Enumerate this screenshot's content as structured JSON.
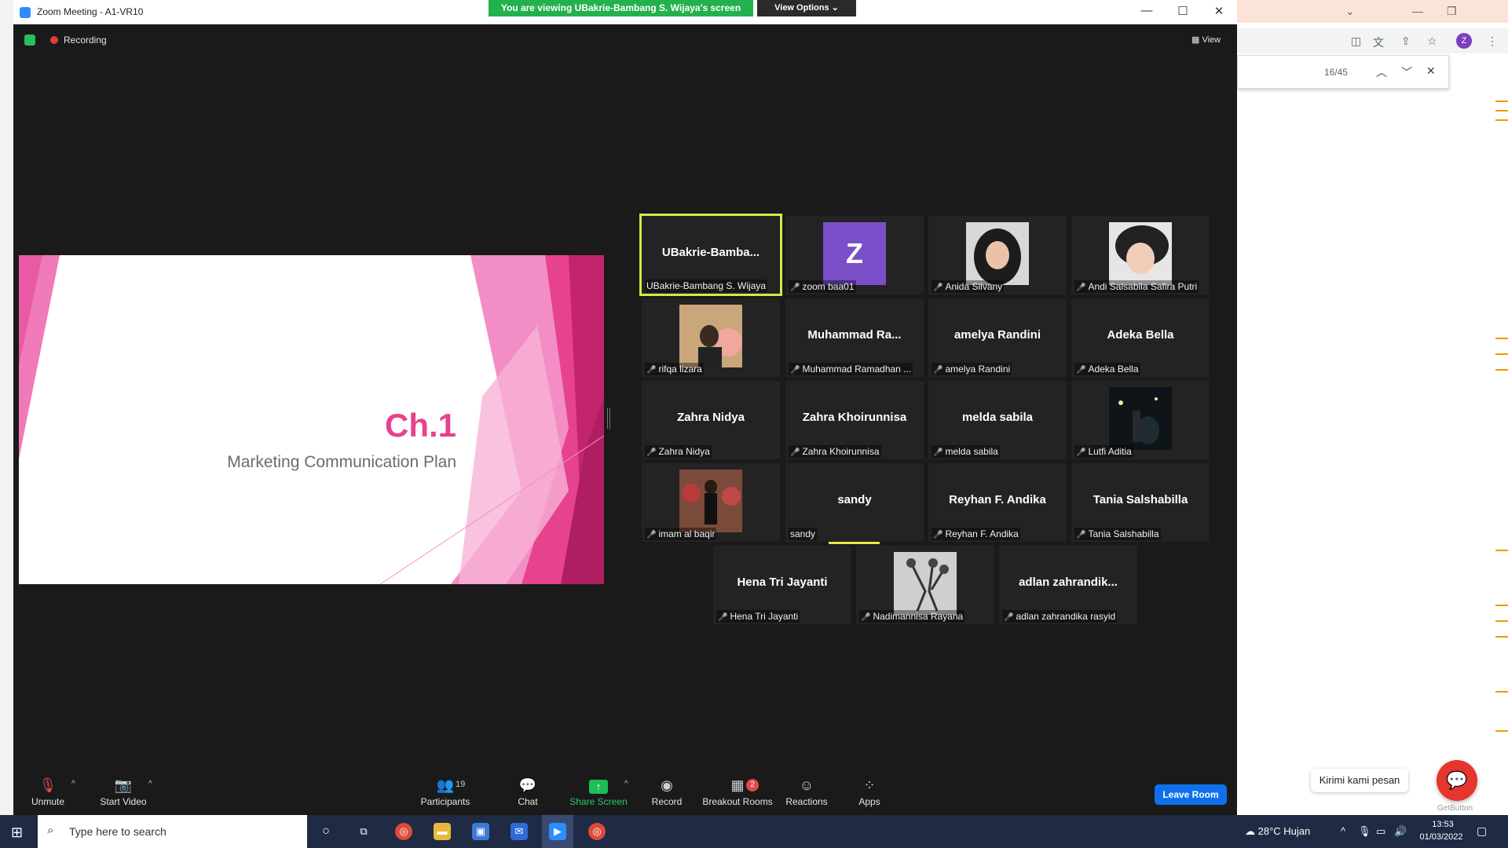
{
  "zoom": {
    "window_title": "Zoom Meeting - A1-VR10",
    "viewing_banner": "You are viewing UBakrie-Bambang S. Wijaya's screen",
    "view_options": "View Options ⌄",
    "recording_label": "Recording",
    "view_label": "View",
    "slide": {
      "title": "Ch.1",
      "subtitle": "Marketing Communication Plan"
    },
    "tiles": [
      {
        "name": "UBakrie-Bamba...",
        "label": "UBakrie-Bambang S. Wijaya",
        "muted": false,
        "photo": false,
        "active": true
      },
      {
        "name": "",
        "label": "zoom baa01",
        "muted": true,
        "avatar_letter": "Z",
        "avatar_color": "#7b4fc9"
      },
      {
        "name": "",
        "label": "Anida Silvany",
        "muted": true,
        "photo": true
      },
      {
        "name": "",
        "label": "Andi Salsabila Safira Putri",
        "muted": true,
        "photo": true
      },
      {
        "name": "",
        "label": "rifqa lizara",
        "muted": true,
        "photo": true
      },
      {
        "name": "Muhammad Ra...",
        "label": "Muhammad Ramadhan ...",
        "muted": true
      },
      {
        "name": "amelya Randini",
        "label": "amelya Randini",
        "muted": true
      },
      {
        "name": "Adeka Bella",
        "label": "Adeka Bella",
        "muted": true
      },
      {
        "name": "Zahra Nidya",
        "label": "Zahra Nidya",
        "muted": true
      },
      {
        "name": "Zahra Khoirunnisa",
        "label": "Zahra Khoirunnisa",
        "muted": true
      },
      {
        "name": "melda sabila",
        "label": "melda sabila",
        "muted": true
      },
      {
        "name": "",
        "label": "Lutfi Aditia",
        "muted": true,
        "photo": true
      },
      {
        "name": "",
        "label": "imam al baqir",
        "muted": true,
        "photo": true
      },
      {
        "name": "sandy",
        "label": "sandy",
        "muted": false,
        "speaking": true
      },
      {
        "name": "Reyhan F. Andika",
        "label": "Reyhan F. Andika",
        "muted": true
      },
      {
        "name": "Tania Salshabilla",
        "label": "Tania Salshabilla",
        "muted": true
      },
      {
        "name": "Hena Tri Jayanti",
        "label": "Hena Tri Jayanti",
        "muted": true
      },
      {
        "name": "",
        "label": "Nadimannisa Rayana",
        "muted": true,
        "photo": true
      },
      {
        "name": "adlan zahrandik...",
        "label": "adlan zahrandika rasyid",
        "muted": true
      }
    ],
    "toolbar": {
      "unmute": "Unmute",
      "start_video": "Start Video",
      "participants": "Participants",
      "participants_count": "19",
      "chat": "Chat",
      "share_screen": "Share Screen",
      "record": "Record",
      "breakout_rooms": "Breakout Rooms",
      "breakout_count": "2",
      "reactions": "Reactions",
      "apps": "Apps",
      "leave_room": "Leave Room"
    }
  },
  "browser": {
    "find_count": "16/45",
    "avatar_letter": "Z",
    "chat_prompt": "Kirimi kami pesan",
    "getbutton_label": "GetButton"
  },
  "taskbar": {
    "search_placeholder": "Type here to search",
    "weather": "28°C  Hujan",
    "time": "13:53",
    "date": "01/03/2022"
  }
}
